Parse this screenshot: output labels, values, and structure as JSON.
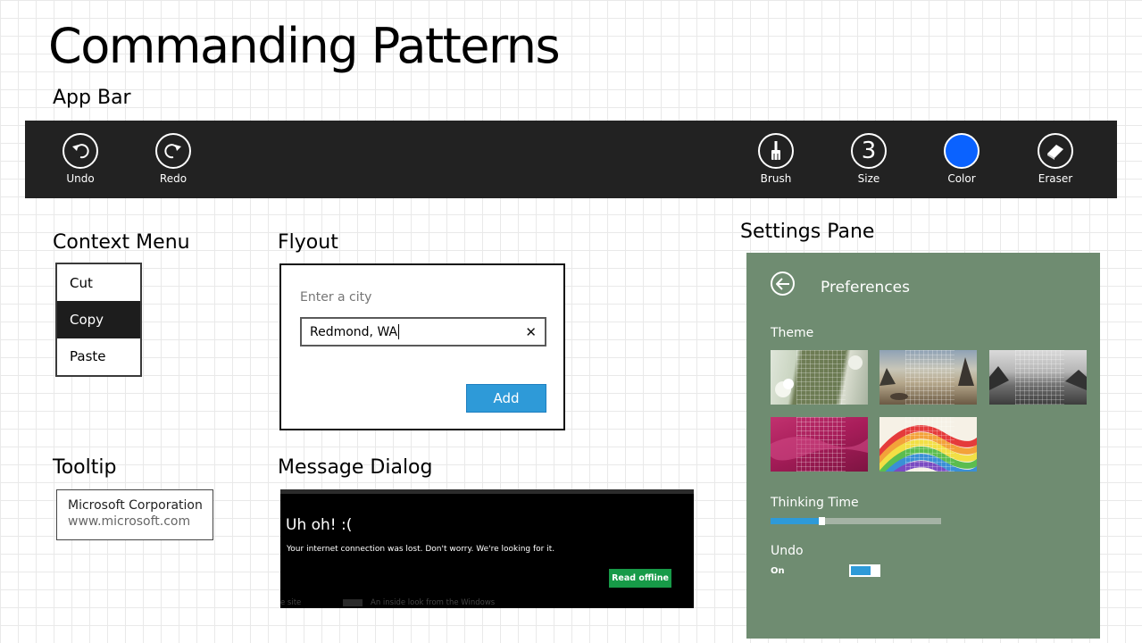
{
  "page": {
    "title": "Commanding Patterns"
  },
  "sections": {
    "app_bar": "App Bar",
    "context_menu": "Context Menu",
    "flyout": "Flyout",
    "settings_pane": "Settings Pane",
    "tooltip": "Tooltip",
    "message_dialog": "Message Dialog"
  },
  "app_bar": {
    "left_commands": [
      {
        "label": "Undo",
        "icon": "undo-icon"
      },
      {
        "label": "Redo",
        "icon": "redo-icon"
      }
    ],
    "right_commands": [
      {
        "label": "Brush",
        "icon": "brush-icon"
      },
      {
        "label": "Size",
        "icon": "size-icon",
        "value": "3"
      },
      {
        "label": "Color",
        "icon": "color-swatch-icon",
        "color": "#0a62ff"
      },
      {
        "label": "Eraser",
        "icon": "eraser-icon"
      }
    ]
  },
  "context_menu": {
    "items": [
      "Cut",
      "Copy",
      "Paste"
    ],
    "selected": "Copy"
  },
  "flyout": {
    "label": "Enter a city",
    "input_value": "Redmond, WA",
    "clear_glyph": "✕",
    "button": "Add"
  },
  "tooltip": {
    "line1": "Microsoft Corporation",
    "line2": "www.microsoft.com"
  },
  "message_dialog": {
    "title": "Uh oh! :(",
    "body": "Your internet connection was lost.  Don't worry.  We're looking for it.",
    "button": "Read offline",
    "background_text_1": "e site",
    "background_text_2": "An inside look from the Windows"
  },
  "settings_pane": {
    "title": "Preferences",
    "theme_label": "Theme",
    "themes": [
      "green-floral-theme",
      "beach-theme",
      "grayscale-coast-theme",
      "magenta-theme",
      "rainbow-theme"
    ],
    "thinking_time_label": "Thinking Time",
    "thinking_time_value": 0.3,
    "undo_label": "Undo",
    "undo_state": "On"
  },
  "colors": {
    "app_bar_bg": "#222222",
    "accent_blue": "#2e9ad8",
    "settings_bg": "#6f8c71",
    "dialog_button": "#179a48",
    "color_swatch": "#0a62ff"
  }
}
